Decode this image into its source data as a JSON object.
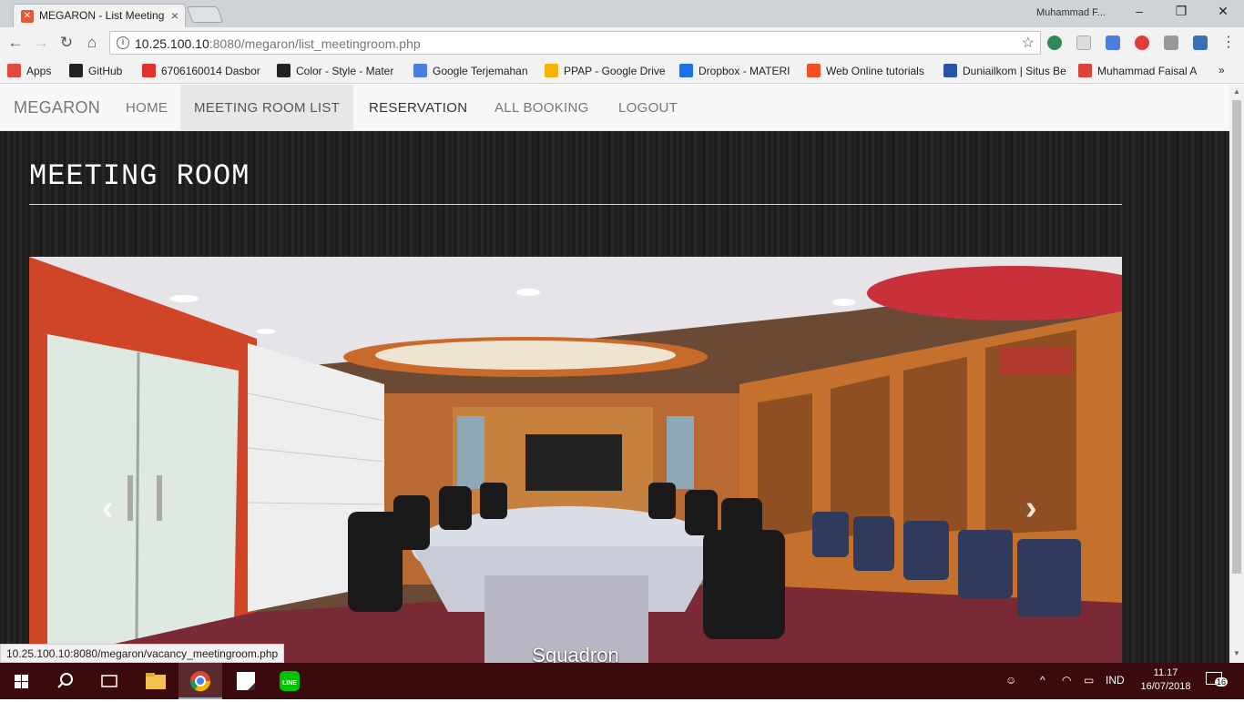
{
  "browser": {
    "tab_title": "MEGARON - List Meeting",
    "tab_favicon": "xampp-icon",
    "profile_name": "Muhammad F...",
    "url_host": "10.25.100.10",
    "url_rest": ":8080/megaron/list_meetingroom.php",
    "bookmarks": [
      {
        "label": "Apps",
        "icon": "apps-grid-icon",
        "color": "#e04a3f"
      },
      {
        "label": "GitHub",
        "icon": "github-icon",
        "color": "#222222"
      },
      {
        "label": "6706160014 Dasbor",
        "icon": "bookmark-red-icon",
        "color": "#e0322b"
      },
      {
        "label": "Color - Style - Mater",
        "icon": "github-icon",
        "color": "#222222"
      },
      {
        "label": "Google Terjemahan",
        "icon": "translate-icon",
        "color": "#4a7ee0"
      },
      {
        "label": "PPAP - Google Drive",
        "icon": "drive-icon",
        "color": "#f4b400"
      },
      {
        "label": "Dropbox - MATERI",
        "icon": "dropbox-icon",
        "color": "#1f6fe5"
      },
      {
        "label": "Web Online tutorials",
        "icon": "windows-color-icon",
        "color": "#f25022"
      },
      {
        "label": "Duniailkom | Situs Be",
        "icon": "di-icon",
        "color": "#2855a8"
      },
      {
        "label": "Muhammad Faisal A",
        "icon": "chrome-icon",
        "color": "#db4437"
      }
    ],
    "status_url": "10.25.100.10:8080/megaron/vacancy_meetingroom.php"
  },
  "navbar": {
    "brand": "MEGARON",
    "items": [
      {
        "label": "HOME"
      },
      {
        "label": "MEETING ROOM LIST"
      },
      {
        "label": "RESERVATION"
      },
      {
        "label": "ALL BOOKING"
      },
      {
        "label": "LOGOUT"
      }
    ]
  },
  "main": {
    "heading": "MEETING ROOM",
    "carousel": {
      "caption": "Squadron",
      "prev_glyph": "‹",
      "next_glyph": "›"
    }
  },
  "taskbar": {
    "language": "IND",
    "time": "11.17",
    "date": "16/07/2018",
    "notification_count": "16"
  },
  "colors": {
    "navbar_bg": "#f8f8f8",
    "active_nav_bg": "#e7e7e7",
    "page_bg": "#1d1d1d",
    "taskbar_bg": "#3a0a0c"
  }
}
